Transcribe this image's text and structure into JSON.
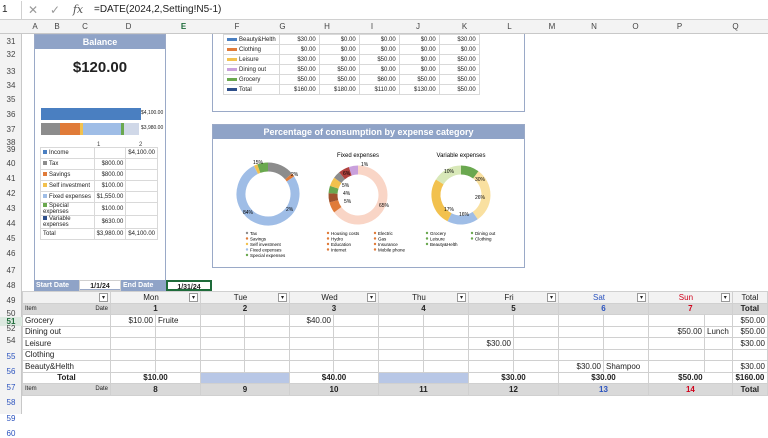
{
  "formula_bar": {
    "name_box": "1",
    "formula": "=DATE(2024,2,Setting!N5-1)"
  },
  "columns": [
    "A",
    "B",
    "C",
    "D",
    "E",
    "F",
    "G",
    "H",
    "I",
    "J",
    "K",
    "L",
    "M",
    "N",
    "O",
    "P",
    "Q"
  ],
  "rows": [
    "31",
    "32",
    "33",
    "34",
    "35",
    "36",
    "37",
    "38",
    "39",
    "40",
    "41",
    "42",
    "43",
    "44",
    "45",
    "46",
    "47",
    "48",
    "49",
    "50",
    "51",
    "52",
    "54",
    "55",
    "56",
    "57",
    "58",
    "59",
    "60",
    "66",
    "67"
  ],
  "balance": {
    "title": "Balance",
    "amount": "$120.00",
    "bar_labels": [
      "$4,100.00",
      "$3,980.00"
    ],
    "axis": [
      "1",
      "2"
    ],
    "rows": [
      {
        "label": "Income",
        "c1": "",
        "c2": "$4,100.00",
        "color": "#4a7fc1"
      },
      {
        "label": "Tax",
        "c1": "$800.00",
        "c2": "",
        "color": "#8c8c8c"
      },
      {
        "label": "Savings",
        "c1": "$800.00",
        "c2": "",
        "color": "#e07b39"
      },
      {
        "label": "Self investment",
        "c1": "$100.00",
        "c2": "",
        "color": "#f2c14e"
      },
      {
        "label": "Fixed expenses",
        "c1": "$1,550.00",
        "c2": "",
        "color": "#9fbde6"
      },
      {
        "label": "Special expenses",
        "c1": "$100.00",
        "c2": "",
        "color": "#6aa84f"
      },
      {
        "label": "Variable expenses",
        "c1": "$630.00",
        "c2": "",
        "color": "#2e4f8a"
      },
      {
        "label": "Total",
        "c1": "$3,980.00",
        "c2": "$4,100.00",
        "color": ""
      }
    ]
  },
  "top_table": [
    {
      "label": "Beauty&Helth",
      "v": [
        "$30.00",
        "$0.00",
        "$0.00",
        "$0.00",
        "$30.00"
      ],
      "color": "#4a7fc1"
    },
    {
      "label": "Clothing",
      "v": [
        "$0.00",
        "$0.00",
        "$0.00",
        "$0.00",
        "$0.00"
      ],
      "color": "#e07b39"
    },
    {
      "label": "Leisure",
      "v": [
        "$30.00",
        "$0.00",
        "$50.00",
        "$0.00",
        "$50.00"
      ],
      "color": "#f2c14e"
    },
    {
      "label": "Dining out",
      "v": [
        "$50.00",
        "$50.00",
        "$0.00",
        "$0.00",
        "$50.00"
      ],
      "color": "#c9a0dc"
    },
    {
      "label": "Grocery",
      "v": [
        "$50.00",
        "$50.00",
        "$60.00",
        "$50.00",
        "$50.00"
      ],
      "color": "#6aa84f"
    },
    {
      "label": "Total",
      "v": [
        "$160.00",
        "$180.00",
        "$110.00",
        "$130.00",
        "$50.00"
      ],
      "color": "#2e4f8a"
    }
  ],
  "pct_chart": {
    "title": "Percentage of consumption by expense category",
    "fixed_title": "Fixed expenses",
    "variable_title": "Variable expenses",
    "left_labels": [
      "15%",
      "2%",
      "84%",
      "2%"
    ],
    "fixed_labels": [
      "1%",
      "6%",
      "5%",
      "4%",
      "5%",
      "65%"
    ],
    "variable_labels": [
      "10%",
      "30%",
      "17%",
      "26%",
      "16%"
    ],
    "legend_left": [
      "Tax",
      "Savings",
      "Self investment",
      "Fixed expenses",
      "Special expenses"
    ],
    "legend_fixed": [
      "Housing costs",
      "Hydro",
      "Education",
      "Internet",
      "Electric",
      "Gas",
      "Insurance",
      "Mobile phone"
    ],
    "legend_variable": [
      "Grocery",
      "Leisure",
      "Beauty&Helth",
      "Dining out",
      "Clothing"
    ]
  },
  "dates": {
    "start_label": "Start Date",
    "start": "1/1/24",
    "end_label": "End Date",
    "end": "1/31/24"
  },
  "calendar": {
    "dow": [
      "Mon",
      "Tue",
      "Wed",
      "Thu",
      "Fri",
      "Sat",
      "Sun",
      "Total"
    ],
    "item_label": "Item",
    "date_label": "Date",
    "week1": [
      "1",
      "2",
      "3",
      "4",
      "5",
      "6",
      "7",
      "Total"
    ],
    "week2": [
      "8",
      "9",
      "10",
      "11",
      "12",
      "13",
      "14",
      "Total"
    ],
    "rows": [
      {
        "label": "Grocery",
        "cells": [
          "$10.00",
          "Fruite",
          "",
          "",
          "$40.00",
          "",
          "",
          "",
          "",
          "",
          "",
          "",
          "",
          ""
        ],
        "total": "$50.00"
      },
      {
        "label": "Dining out",
        "cells": [
          "",
          "",
          "",
          "",
          "",
          "",
          "",
          "",
          "",
          "",
          "",
          "",
          "$50.00",
          "Lunch"
        ],
        "total": "$50.00"
      },
      {
        "label": "Leisure",
        "cells": [
          "",
          "",
          "",
          "",
          "",
          "",
          "",
          "",
          "$30.00",
          "",
          "",
          "",
          "",
          ""
        ],
        "total": "$30.00"
      },
      {
        "label": "Clothing",
        "cells": [
          "",
          "",
          "",
          "",
          "",
          "",
          "",
          "",
          "",
          "",
          "",
          "",
          "",
          ""
        ],
        "total": ""
      },
      {
        "label": "Beauty&Helth",
        "cells": [
          "",
          "",
          "",
          "",
          "",
          "",
          "",
          "",
          "",
          "",
          "$30.00",
          "Shampoo",
          "",
          ""
        ],
        "total": "$30.00"
      }
    ],
    "total_label": "Total",
    "totals": [
      "$10.00",
      "",
      "$40.00",
      "",
      "$30.00",
      "$30.00",
      "$50.00",
      "$160.00"
    ]
  }
}
